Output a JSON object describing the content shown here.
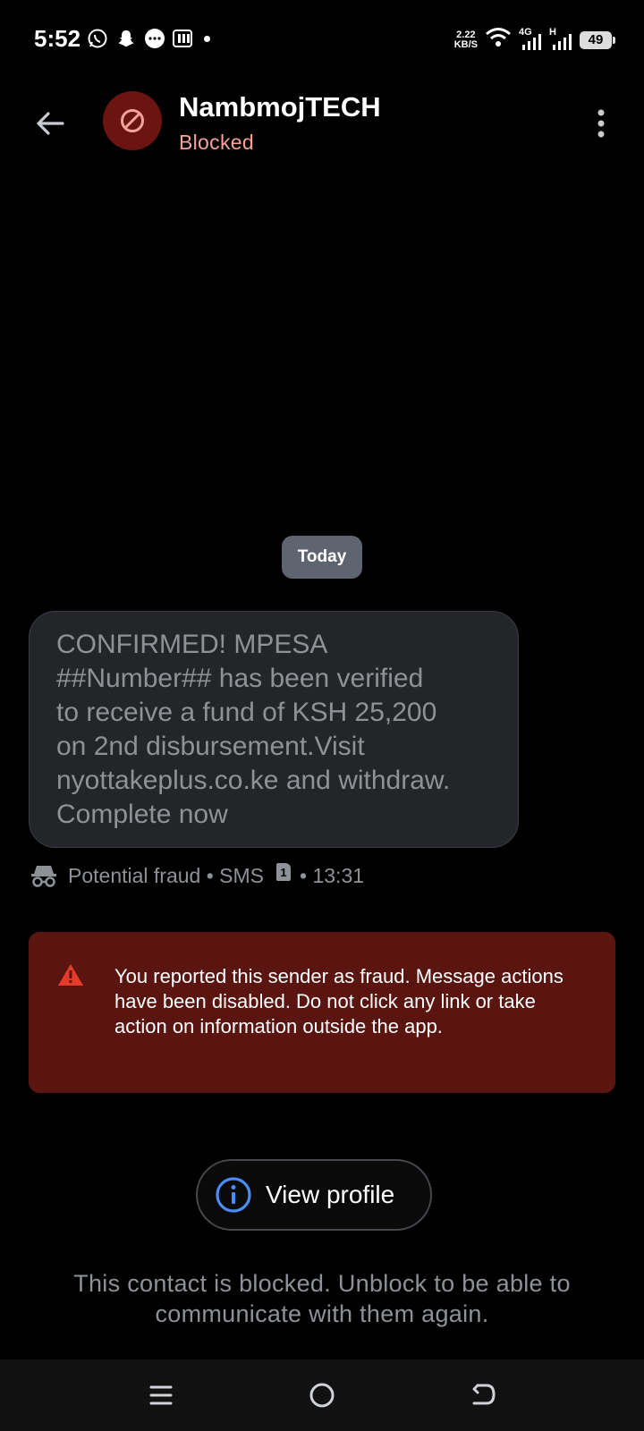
{
  "status_bar": {
    "time": "5:52",
    "data_rate_value": "2.22",
    "data_rate_unit": "KB/S",
    "network_4g": "4G",
    "network_h": "H",
    "battery": "49"
  },
  "header": {
    "contact_name": "NambmojTECH",
    "status": "Blocked"
  },
  "conversation": {
    "date_chip": "Today",
    "message": {
      "text": "CONFIRMED! MPESA\n##Number##  has been verified\nto receive a fund of KSH 25,200\non 2nd disbursement.Visit\nnyottakeplus.co.ke and withdraw.\nComplete now",
      "label": "Potential fraud",
      "channel": "SMS",
      "sim": "1",
      "time": "13:31"
    }
  },
  "fraud_banner": {
    "text": "You reported this sender as fraud. Message actions have been disabled. Do not click any link or take action on information outside the app."
  },
  "view_profile": {
    "label": "View profile"
  },
  "blocked_notice": "This contact is blocked. Unblock to be able to communicate with them again.",
  "colors": {
    "background": "#000000",
    "bubble": "#232528",
    "fraud_banner": "#5b1510",
    "blocked_accent": "#f4a39b",
    "info_icon": "#4a8bf5",
    "warning_icon": "#e53b2c"
  },
  "icons": {
    "back": "arrow-left-icon",
    "avatar": "blocked-icon",
    "more": "more-vert-icon",
    "meta": "spy-icon",
    "warning": "warning-triangle-icon",
    "info": "info-icon",
    "nav": [
      "menu-icon",
      "home-icon",
      "back-icon"
    ]
  }
}
